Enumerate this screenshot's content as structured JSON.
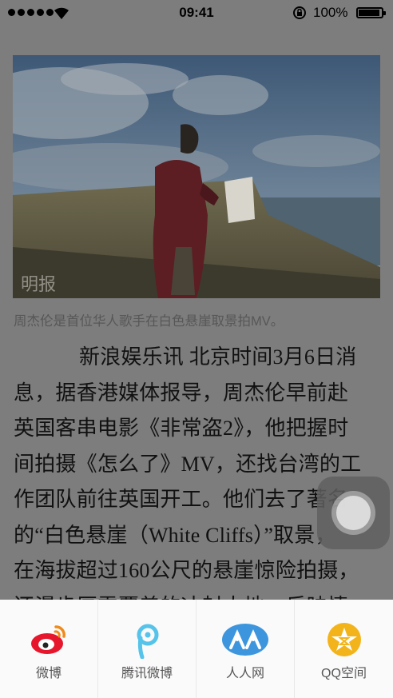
{
  "status_bar": {
    "time": "09:41",
    "battery_percent": "100%",
    "battery_level": 1.0,
    "icons": [
      "signal-dots-icon",
      "wifi-icon",
      "orientation-lock-icon",
      "battery-icon"
    ]
  },
  "article": {
    "image_alt_icon": "photo-man-on-white-cliffs",
    "watermark": "明报",
    "caption": "周杰伦是首位华人歌手在白色悬崖取景拍MV。",
    "lines": [
      "新浪娱乐讯 北京时间3月6日消",
      "息，据香港媒体报导，周杰伦早前赴",
      "英国客串电影《非常盗2》，他把握时",
      "间拍摄《怎么了》MV，还找台湾的工",
      "作团队前往英国开工。他们去了著名",
      "的“白色悬崖（White Cliffs）”取景，",
      "在海拔超过160公尺的悬崖惊险拍摄，",
      "还漫步厚雪覆盖的冰封大地，反映情"
    ]
  },
  "share": {
    "items": [
      {
        "label": "微博",
        "icon": "weibo-icon",
        "color": "#e6162d"
      },
      {
        "label": "腾讯微博",
        "icon": "tencent-weibo-icon",
        "color": "#2fb5e6"
      },
      {
        "label": "人人网",
        "icon": "renren-icon",
        "color": "#1f7fd2"
      },
      {
        "label": "QQ空间",
        "icon": "qzone-icon",
        "color": "#f3b41b"
      }
    ]
  }
}
